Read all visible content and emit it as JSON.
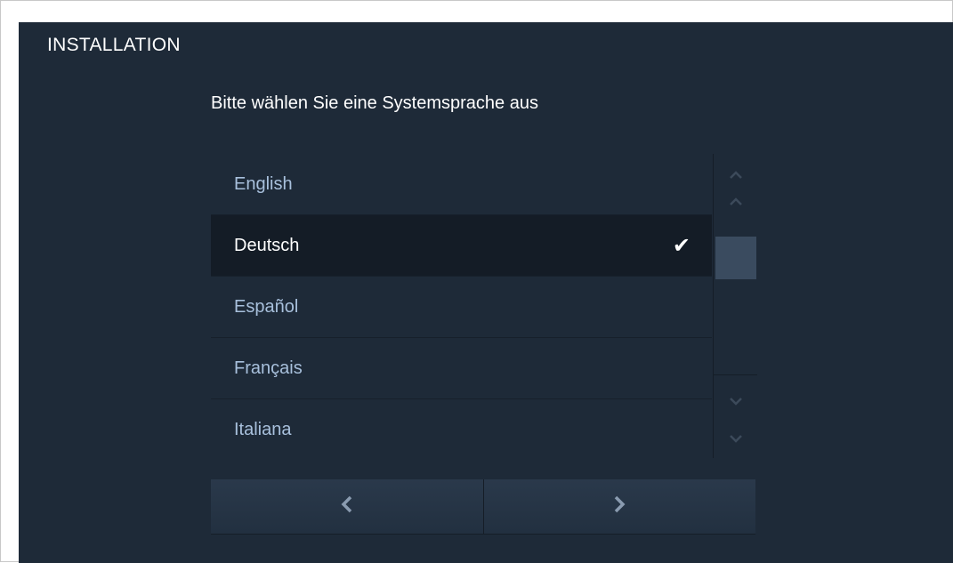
{
  "header": {
    "title": "INSTALLATION"
  },
  "prompt": "Bitte wählen Sie eine Systemsprache aus",
  "languages": [
    {
      "label": "English",
      "selected": false
    },
    {
      "label": "Deutsch",
      "selected": true
    },
    {
      "label": "Español",
      "selected": false
    },
    {
      "label": "Français",
      "selected": false
    },
    {
      "label": "Italiana",
      "selected": false
    }
  ],
  "icons": {
    "selected_mark": "✔",
    "scroll_up": "chevron-up-icon",
    "scroll_down": "chevron-down-icon",
    "back": "chevron-left-icon",
    "next": "chevron-right-icon"
  },
  "colors": {
    "background": "#1e2a38",
    "selected_row": "#141c26",
    "unselected_text": "#a8c0dc",
    "selected_text": "#ffffff",
    "scroll_thumb": "#3a4b5f",
    "nav_arrow": "#8a9bb0"
  }
}
